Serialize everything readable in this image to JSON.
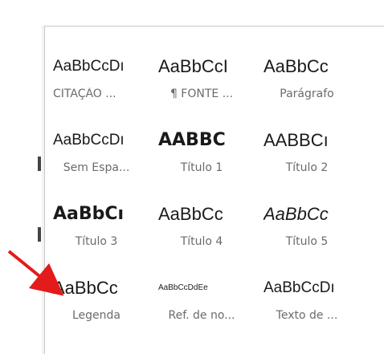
{
  "styles_gallery": {
    "tiles": [
      {
        "preview": "AaBbCcDı",
        "label": "CITAÇÃO ...",
        "style": "p-normal",
        "col": 0,
        "row": 0
      },
      {
        "preview": "AaBbCcI",
        "label": "¶ FONTE ...",
        "style": "p-sans",
        "col": 1,
        "row": 0
      },
      {
        "preview": "AaBbCc",
        "label": "Parágrafo",
        "style": "p-sans",
        "col": 2,
        "row": 0
      },
      {
        "preview": "AaBbCcDı",
        "label": "Sem Espa...",
        "style": "p-normal",
        "col": 0,
        "row": 1
      },
      {
        "preview": "AABBC",
        "label": "Título 1",
        "style": "p-t1",
        "col": 1,
        "row": 1
      },
      {
        "preview": "AABBCı",
        "label": "Título 2",
        "style": "p-caps",
        "col": 2,
        "row": 1
      },
      {
        "preview": "AaBbCı",
        "label": "Título 3",
        "style": "p-t3",
        "col": 0,
        "row": 2
      },
      {
        "preview": "AaBbCc",
        "label": "Título 4",
        "style": "p-sans",
        "col": 1,
        "row": 2
      },
      {
        "preview": "AaBbCc",
        "label": "Título 5",
        "style": "p-italic",
        "col": 2,
        "row": 2
      },
      {
        "preview": "AaBbCc",
        "label": "Legenda",
        "style": "p-sans",
        "col": 0,
        "row": 3
      },
      {
        "preview": "AaBbCcDdEe",
        "label": "Ref. de no...",
        "style": "p-small",
        "col": 1,
        "row": 3
      },
      {
        "preview": "AaBbCcDı",
        "label": "Texto de ...",
        "style": "p-normal",
        "col": 2,
        "row": 3
      }
    ]
  },
  "annotation": {
    "arrow_color": "#e31b1b"
  }
}
